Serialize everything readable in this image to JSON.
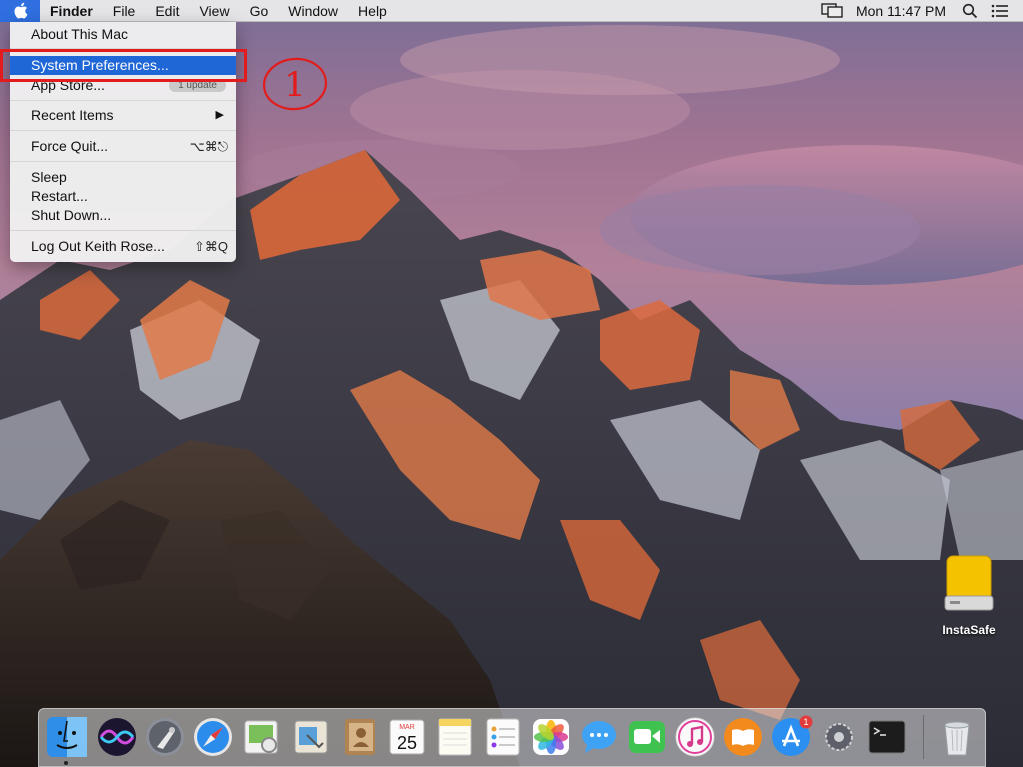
{
  "menubar": {
    "app_name": "Finder",
    "menus": [
      "File",
      "Edit",
      "View",
      "Go",
      "Window",
      "Help"
    ],
    "clock": "Mon 11:47 PM",
    "icons": [
      "display-mirroring-icon",
      "search-icon",
      "notification-center-icon"
    ]
  },
  "apple_menu": {
    "items": [
      {
        "label": "About This Mac"
      },
      {
        "label": "System Preferences..."
      },
      {
        "label": "App Store...",
        "badge": "1 update"
      },
      {
        "label": "Recent Items",
        "arrow": "▶"
      },
      {
        "label": "Force Quit...",
        "shortcut": "⌥⌘⎋"
      },
      {
        "label": "Sleep"
      },
      {
        "label": "Restart..."
      },
      {
        "label": "Shut Down..."
      },
      {
        "label": "Log Out Keith Rose...",
        "shortcut": "⇧⌘Q"
      }
    ],
    "highlighted": "System Preferences..."
  },
  "annotation": {
    "step_number": "1",
    "color": "#e21c1c"
  },
  "desktop": {
    "drive_label": "InstaSafe"
  },
  "dock": {
    "icons": [
      "finder-icon",
      "siri-icon",
      "launchpad-icon",
      "safari-icon",
      "preview-icon",
      "mail-icon",
      "contacts-icon",
      "calendar-icon",
      "notes-icon",
      "reminders-icon",
      "photos-icon",
      "messages-icon",
      "facetime-icon",
      "itunes-icon",
      "ibooks-icon",
      "app-store-icon",
      "system-preferences-icon",
      "terminal-icon",
      "trash-icon"
    ],
    "calendar": {
      "month": "MAR",
      "day": "25"
    },
    "app_store_badge": "1"
  },
  "colors": {
    "highlight": "#1f66d6",
    "annotation": "#e21c1c",
    "menubar": "#ececec"
  }
}
